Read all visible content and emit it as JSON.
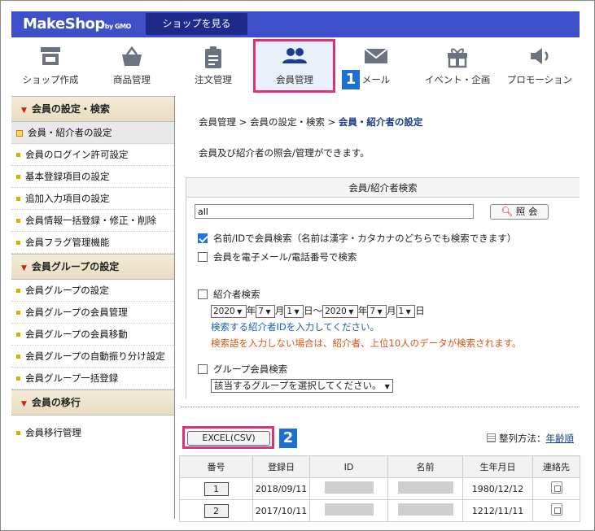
{
  "header": {
    "logo": "MakeShop",
    "logo_sub": "by GMO",
    "shop_button": "ショップを見る"
  },
  "nav": {
    "items": [
      {
        "label": "ショップ作成",
        "icon": "shop-icon"
      },
      {
        "label": "商品管理",
        "icon": "basket-icon"
      },
      {
        "label": "注文管理",
        "icon": "clipboard-icon"
      },
      {
        "label": "会員管理",
        "icon": "users-icon"
      },
      {
        "label": "メール",
        "icon": "mail-icon"
      },
      {
        "label": "イベント・企画",
        "icon": "gift-icon"
      },
      {
        "label": "プロモーション",
        "icon": "speaker-icon"
      }
    ],
    "active": "会員管理"
  },
  "badges": {
    "one": "1",
    "two": "2"
  },
  "sidebar": {
    "sections": [
      {
        "title": "会員の設定・検索",
        "items": [
          "会員・紹介者の設定",
          "会員のログイン許可設定",
          "基本登録項目の設定",
          "追加入力項目の設定",
          "会員情報一括登録・修正・削除",
          "会員フラグ管理機能"
        ]
      },
      {
        "title": "会員グループの設定",
        "items": [
          "会員グループの設定",
          "会員グループの会員管理",
          "会員グループの会員移動",
          "会員グループの自動振り分け設定",
          "会員グループ一括登録"
        ]
      },
      {
        "title": "会員の移行",
        "items": [
          "会員移行管理"
        ]
      }
    ]
  },
  "breadcrumb": {
    "part1": "会員管理 > 会員の設定・検索 > ",
    "current": "会員・紹介者の設定"
  },
  "description": "会員及び紹介者の照会/管理ができます。",
  "search": {
    "panel_title": "会員/紹介者検索",
    "input_value": "all",
    "search_button": "照 会",
    "opt_name_id": "名前/IDで会員検索（名前は漢字・カタカナのどちらでも検索できます）",
    "opt_email_phone": "会員を電子メール/電話番号で検索",
    "opt_referrer": "紹介者検索",
    "date": {
      "from_year": "2020",
      "from_month": "7",
      "from_day": "1",
      "to_year": "2020",
      "to_month": "7",
      "to_day": "1",
      "year_unit": "年",
      "month_unit": "月",
      "day_unit": "日",
      "range_sep": "～"
    },
    "note_blue": "検索する紹介者IDを入力してください。",
    "note_orange": "検索語を入力しない場合は、紹介者、上位10人のデータが検索されます。",
    "opt_group": "グループ会員検索",
    "group_select": "該当するグループを選択してください。"
  },
  "actions": {
    "excel_button": "EXCEL(CSV)",
    "sort_label": "整列方法：",
    "sort_value": "年齢順"
  },
  "table": {
    "headers": [
      "番号",
      "登録日",
      "ID",
      "名前",
      "生年月日",
      "連絡先"
    ],
    "rows": [
      {
        "no": "1",
        "date": "2018/09/11",
        "birth": "1980/12/12"
      },
      {
        "no": "2",
        "date": "2017/10/11",
        "birth": "1212/11/11"
      }
    ]
  },
  "colors": {
    "brand": "#3d50c8",
    "highlight": "#e0307a",
    "badge": "#1a6fd0"
  }
}
